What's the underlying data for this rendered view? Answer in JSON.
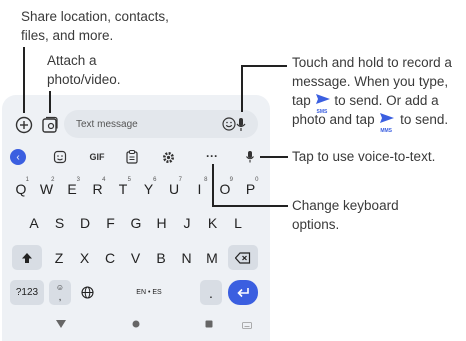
{
  "callouts": {
    "share_line1": "Share location, contacts,",
    "share_line2": "files, and more.",
    "attach_line1": "Attach a",
    "attach_line2": "photo/video.",
    "record_line1": "Touch and hold to record a",
    "record_line2": "message. When you type,",
    "record_line3a": "tap",
    "record_line3b": "to send. Or add a",
    "record_line4a": "photo and tap",
    "record_line4b": "to send.",
    "sms_label": "SMS",
    "mms_label": "MMS",
    "voice": "Tap to use voice-to-text.",
    "options_line1": "Change keyboard",
    "options_line2": "options."
  },
  "composer": {
    "placeholder": "Text message"
  },
  "toolbar": {
    "gif_label": "GIF",
    "more_label": "···"
  },
  "keyboard": {
    "row1": [
      {
        "k": "Q",
        "h": "1"
      },
      {
        "k": "W",
        "h": "2"
      },
      {
        "k": "E",
        "h": "3"
      },
      {
        "k": "R",
        "h": "4"
      },
      {
        "k": "T",
        "h": "5"
      },
      {
        "k": "Y",
        "h": "6"
      },
      {
        "k": "U",
        "h": "7"
      },
      {
        "k": "I",
        "h": "8"
      },
      {
        "k": "O",
        "h": "9"
      },
      {
        "k": "P",
        "h": "0"
      }
    ],
    "row2": [
      "A",
      "S",
      "D",
      "F",
      "G",
      "H",
      "J",
      "K",
      "L"
    ],
    "row3": [
      "Z",
      "X",
      "C",
      "V",
      "B",
      "N",
      "M"
    ],
    "symbols_label": "?123",
    "comma_top": "☺",
    "comma_label": ",",
    "space_label": "EN • ES",
    "period_label": "."
  },
  "colors": {
    "accent": "#3b5fe0",
    "panel": "#eef1f5",
    "func_key": "#d8dde4"
  },
  "icons": {
    "add": "add-circle-icon",
    "gallery": "gallery-icon",
    "mic": "mic-icon",
    "emoji": "emoji-icon",
    "sticker": "sticker-icon",
    "clipboard": "clipboard-icon",
    "settings": "gear-icon",
    "send": "send-icon"
  }
}
